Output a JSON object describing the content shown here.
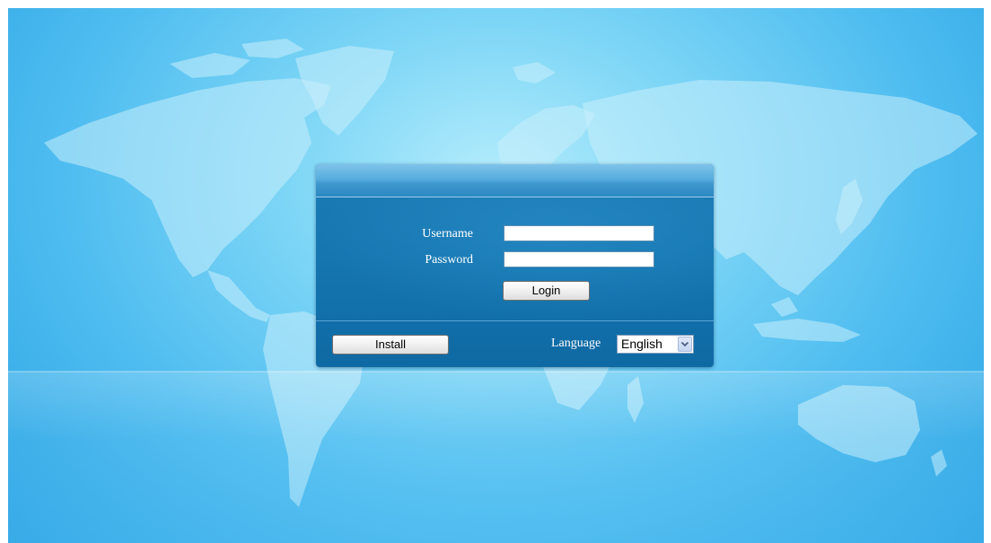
{
  "login": {
    "username_label": "Username",
    "password_label": "Password",
    "username_value": "",
    "password_value": "",
    "login_button": "Login"
  },
  "footer": {
    "install_button": "Install",
    "language_label": "Language",
    "language_selected": "English",
    "language_options": [
      "English"
    ]
  },
  "colors": {
    "dialog_background": "#1576b0",
    "titlebar": "#57aede",
    "page_background": "#4fbdf0"
  },
  "icons": {
    "dropdown": "chevron-down-icon",
    "background": "world-map"
  }
}
